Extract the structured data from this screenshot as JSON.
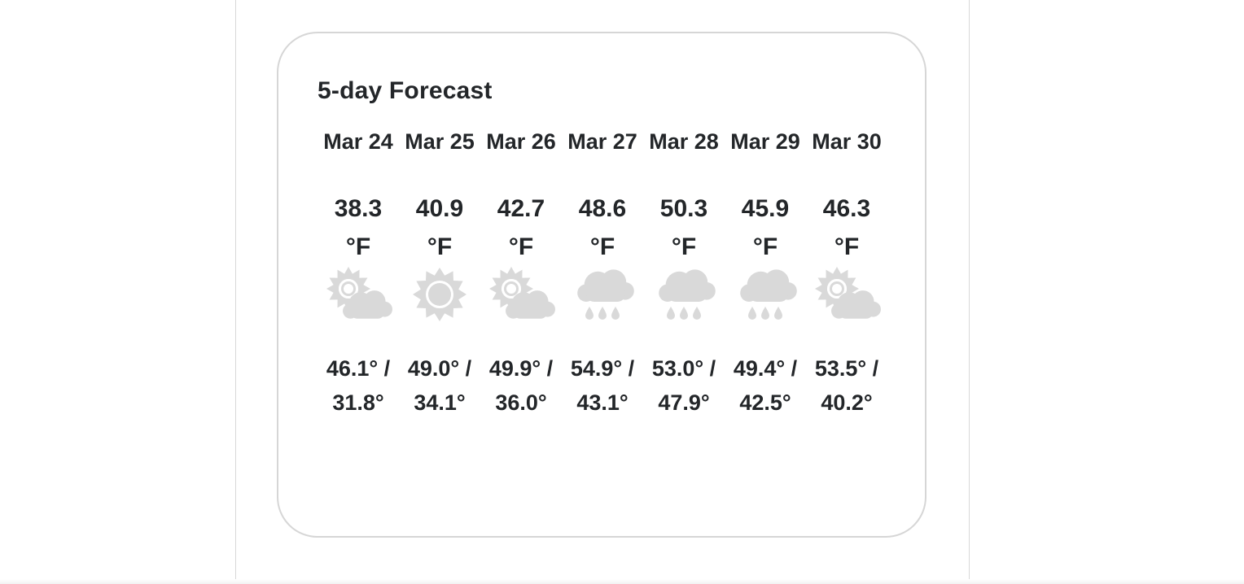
{
  "forecast": {
    "title": "5-day Forecast",
    "days": [
      {
        "date": "Mar 24",
        "temp": "38.3 °F",
        "icon": "partly-cloudy-icon",
        "high": "46.1° /",
        "low": "31.8°"
      },
      {
        "date": "Mar 25",
        "temp": "40.9 °F",
        "icon": "sunny-icon",
        "high": "49.0° /",
        "low": "34.1°"
      },
      {
        "date": "Mar 26",
        "temp": "42.7 °F",
        "icon": "partly-cloudy-icon",
        "high": "49.9° /",
        "low": "36.0°"
      },
      {
        "date": "Mar 27",
        "temp": "48.6 °F",
        "icon": "rain-icon",
        "high": "54.9° /",
        "low": "43.1°"
      },
      {
        "date": "Mar 28",
        "temp": "50.3 °F",
        "icon": "rain-icon",
        "high": "53.0° /",
        "low": "47.9°"
      },
      {
        "date": "Mar 29",
        "temp": "45.9 °F",
        "icon": "rain-icon",
        "high": "49.4° /",
        "low": "42.5°"
      },
      {
        "date": "Mar 30",
        "temp": "46.3 °F",
        "icon": "partly-cloudy-icon",
        "high": "53.5° /",
        "low": "40.2°"
      }
    ]
  },
  "colors": {
    "text": "#232629",
    "icon": "#d9d9d9",
    "border": "#d6d6d6"
  }
}
